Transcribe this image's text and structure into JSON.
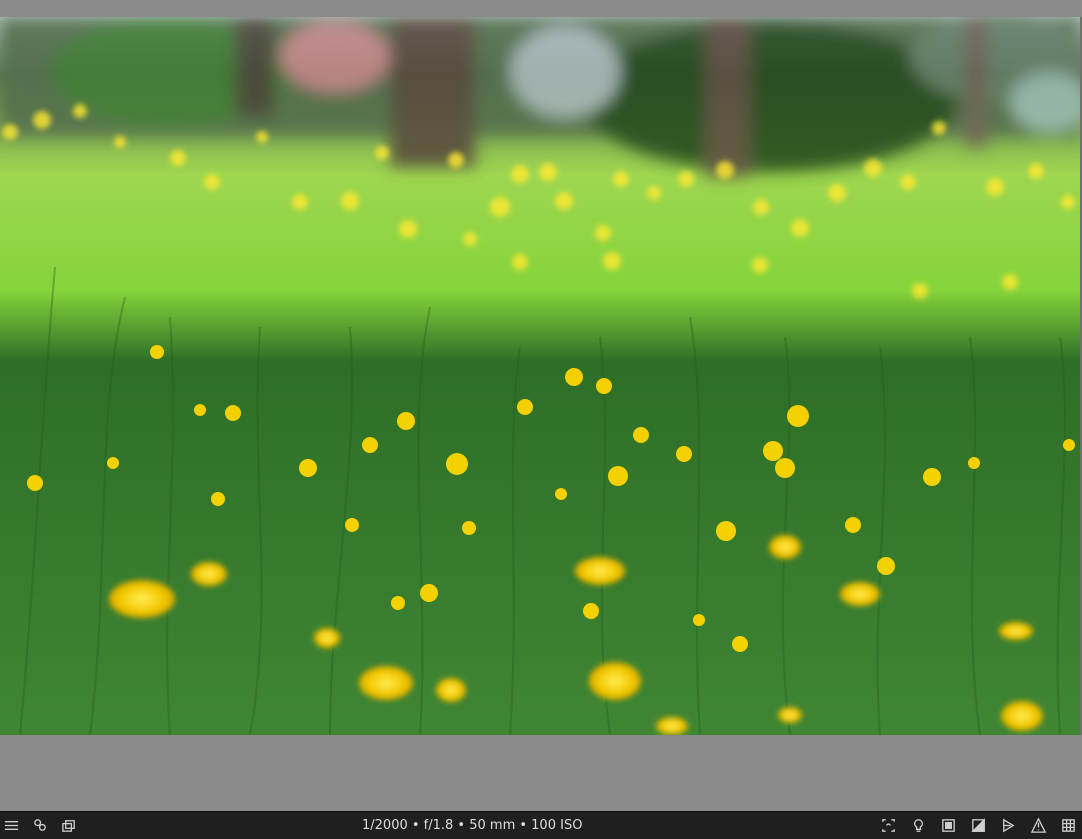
{
  "viewer": {
    "exif": "1/2000 • f/1.8 • 50 mm • 100 ISO",
    "image_subject": "yellow wildflowers in green grass with blurred trees in background"
  },
  "toolbar": {
    "left_icons": [
      "hamburger-menu-icon",
      "color-picker-icon",
      "duplicate-icon"
    ],
    "right_icons": [
      "focus-peaking-icon",
      "bulb-icon",
      "overlay-icon",
      "softproof-icon",
      "gamut-check-icon",
      "warning-icon",
      "grid-icon"
    ]
  },
  "colors": {
    "toolbar_bg": "#1f1f1f",
    "workspace_bg": "#8a8a8a",
    "grass": "#3b7f2d",
    "flower": "#f4c400"
  }
}
